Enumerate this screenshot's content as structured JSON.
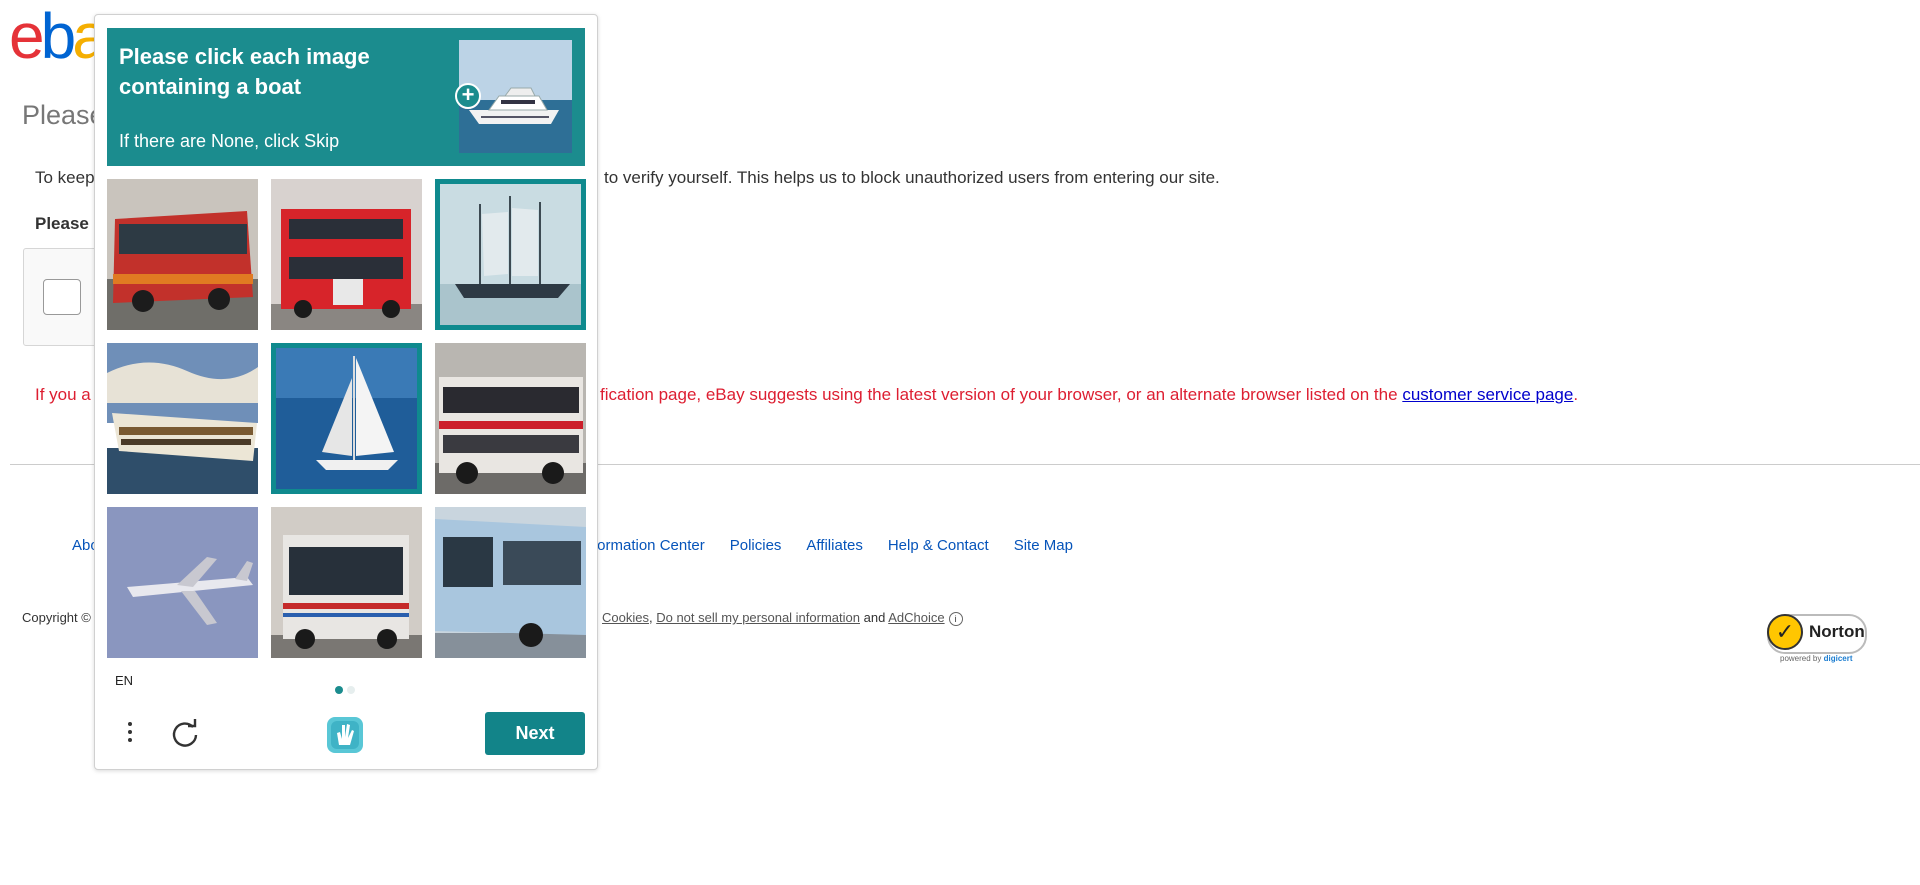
{
  "page": {
    "logo_letters": [
      "e",
      "b",
      "a"
    ],
    "logo_colors": [
      "#e53238",
      "#0064d2",
      "#f5af02"
    ],
    "title": "Please",
    "intro_left": "To keep",
    "intro_right": "to verify yourself. This helps us to block unauthorized users from entering our site.",
    "please_label": "Please",
    "warning_left": "If you a",
    "warning_right": "fication page, eBay suggests using the latest version of your browser, or an alternate browser listed on the",
    "warning_link": "customer service page",
    "warning_period": ".",
    "footer": {
      "left_partial": "Abo",
      "links": [
        "formation Center",
        "Policies",
        "Affiliates",
        "Help & Contact",
        "Site Map"
      ]
    },
    "copyright_partial": "Copyright ©",
    "legal": {
      "cookies": "Cookies",
      "comma": ",",
      "do_not_sell": "Do not sell my personal information",
      "and": "and",
      "adchoice": "AdChoice",
      "info_glyph": "i"
    },
    "norton": {
      "name": "Norton",
      "powered_by": "powered by",
      "brand": "digicert",
      "check_glyph": "✓"
    }
  },
  "captcha": {
    "title": "Please click each image containing a boat",
    "subtitle": "If there are None, click Skip",
    "plus_glyph": "+",
    "tiles": [
      {
        "subject": "red-bus",
        "selected": false
      },
      {
        "subject": "red-double-decker-bus",
        "selected": false
      },
      {
        "subject": "sailing-ship",
        "selected": true
      },
      {
        "subject": "cruise-ship",
        "selected": false
      },
      {
        "subject": "sailboat",
        "selected": true
      },
      {
        "subject": "white-red-bus",
        "selected": false
      },
      {
        "subject": "airplane",
        "selected": false
      },
      {
        "subject": "city-bus",
        "selected": false
      },
      {
        "subject": "blue-bus",
        "selected": false
      }
    ],
    "language": "EN",
    "pages": {
      "current": 1,
      "total": 2
    },
    "next_label": "Next",
    "accent": "#1b8c8e"
  }
}
